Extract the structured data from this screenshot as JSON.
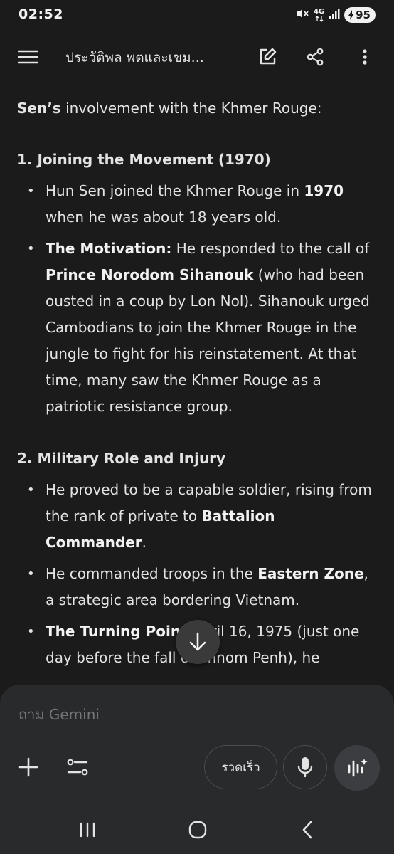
{
  "status_bar": {
    "time": "02:52",
    "network": "4G",
    "battery": "95",
    "icons": [
      "mute-icon",
      "network-4g-icon",
      "signal-icon",
      "battery-charging-icon"
    ]
  },
  "header": {
    "title": "ประวัติพล พตและเขม...",
    "icons": [
      "menu-icon",
      "edit-icon",
      "share-icon",
      "more-vert-icon"
    ]
  },
  "content": {
    "intro_bold": "Sen’s",
    "intro_rest": " involvement with the Khmer Rouge:",
    "sections": [
      {
        "heading": "1. Joining the Movement (1970)",
        "bullets": [
          {
            "parts": [
              "Hun Sen joined the Khmer Rouge in ",
              "1970",
              " when he was about 18 years old."
            ]
          },
          {
            "parts": [
              "The Motivation:",
              " He responded to the call of ",
              "Prince Norodom Sihanouk",
              " (who had been ousted in a coup by Lon Nol). Sihanouk urged Cambodians to join the Khmer Rouge in the jungle to fight for his reinstatement. At that time, many saw the Khmer Rouge as a patriotic resistance group."
            ]
          }
        ]
      },
      {
        "heading": "2. Military Role and Injury",
        "bullets": [
          {
            "parts": [
              "He proved to be a capable soldier, rising from the rank of private to ",
              "Battalion Commander",
              "."
            ]
          },
          {
            "parts": [
              "He commanded troops in the ",
              "Eastern Zone",
              ", a strategic area bordering Vietnam."
            ]
          },
          {
            "parts": [
              "The Turning Point",
              " April 16, 1975 (just one day before the fall of Phnom Penh), he"
            ]
          }
        ]
      }
    ]
  },
  "input": {
    "placeholder": "ถาม Gemini",
    "speed_label": "รวดเร็ว",
    "icons": [
      "plus-icon",
      "tools-icon",
      "mic-icon",
      "live-icon",
      "arrow-down-icon"
    ]
  },
  "nav": {
    "icons": [
      "recents-icon",
      "home-icon",
      "back-icon"
    ]
  },
  "colors": {
    "background": "#1b1b1c",
    "panel": "#282a2c",
    "text": "#e3e3e3",
    "muted": "#a8a8a8"
  }
}
